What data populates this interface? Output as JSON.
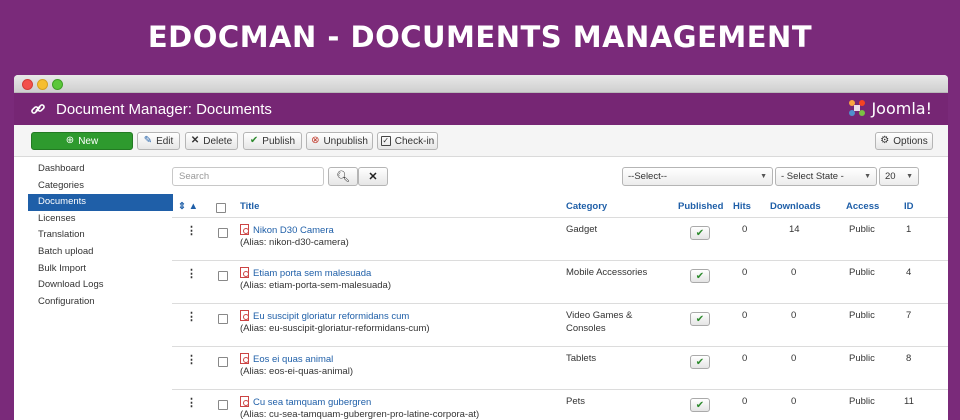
{
  "banner": {
    "title": "EDOCMAN - DOCUMENTS MANAGEMENT"
  },
  "header": {
    "title": "Document Manager: Documents",
    "brand": "Joomla!"
  },
  "toolbar": {
    "new": "New",
    "edit": "Edit",
    "delete": "Delete",
    "publish": "Publish",
    "unpublish": "Unpublish",
    "checkin": "Check-in",
    "options": "Options"
  },
  "sidebar": {
    "items": [
      {
        "label": "Dashboard",
        "active": false
      },
      {
        "label": "Categories",
        "active": false
      },
      {
        "label": "Documents",
        "active": true
      },
      {
        "label": "Licenses",
        "active": false
      },
      {
        "label": "Translation",
        "active": false
      },
      {
        "label": "Batch upload",
        "active": false
      },
      {
        "label": "Bulk Import",
        "active": false
      },
      {
        "label": "Download Logs",
        "active": false
      },
      {
        "label": "Configuration",
        "active": false
      }
    ]
  },
  "filters": {
    "search_placeholder": "Search",
    "category_select": "--Select--",
    "state_select": "- Select State -",
    "limit_select": "20"
  },
  "table": {
    "headers": {
      "title": "Title",
      "category": "Category",
      "published": "Published",
      "hits": "Hits",
      "downloads": "Downloads",
      "access": "Access",
      "id": "ID"
    },
    "rows": [
      {
        "title": "Nikon D30 Camera",
        "alias": "(Alias: nikon-d30-camera)",
        "category": "Gadget",
        "category2": "",
        "hits": "0",
        "downloads": "14",
        "access": "Public",
        "id": "1"
      },
      {
        "title": "Etiam porta sem malesuada",
        "alias": "(Alias: etiam-porta-sem-malesuada)",
        "category": "Mobile Accessories",
        "category2": "",
        "hits": "0",
        "downloads": "0",
        "access": "Public",
        "id": "4"
      },
      {
        "title": "Eu suscipit gloriatur reformidans cum",
        "alias": "(Alias: eu-suscipit-gloriatur-reformidans-cum)",
        "category": "Video Games &",
        "category2": "Consoles",
        "hits": "0",
        "downloads": "0",
        "access": "Public",
        "id": "7"
      },
      {
        "title": "Eos ei quas animal",
        "alias": "(Alias: eos-ei-quas-animal)",
        "category": "Tablets",
        "category2": "",
        "hits": "0",
        "downloads": "0",
        "access": "Public",
        "id": "8"
      },
      {
        "title": "Cu sea tamquam gubergren",
        "alias": "(Alias: cu-sea-tamquam-gubergren-pro-latine-corpora-at)",
        "category": "Pets",
        "category2": "",
        "hits": "0",
        "downloads": "0",
        "access": "Public",
        "id": "11"
      }
    ]
  }
}
